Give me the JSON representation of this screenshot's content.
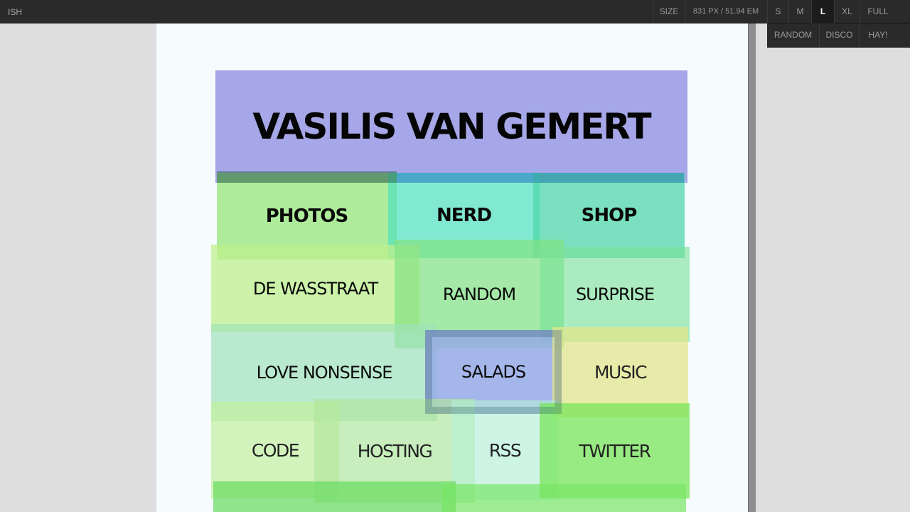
{
  "toolbar": {
    "logo": "ISH",
    "size_label": "SIZE",
    "size_value": "831 PX /  51.94 EM",
    "size_buttons": [
      {
        "label": "S"
      },
      {
        "label": "M"
      },
      {
        "label": "L",
        "active": true
      },
      {
        "label": "XL"
      },
      {
        "label": "FULL"
      }
    ],
    "mode_buttons": [
      {
        "label": "RANDOM"
      },
      {
        "label": "DISCO"
      },
      {
        "label": "HAY!"
      }
    ]
  },
  "page": {
    "title": "VASILIS VAN GEMERT",
    "tiles": [
      {
        "label": "PHOTOS"
      },
      {
        "label": "NERD"
      },
      {
        "label": "SHOP"
      },
      {
        "label": "DE WASSTRAAT"
      },
      {
        "label": "RANDOM"
      },
      {
        "label": "SURPRISE"
      },
      {
        "label": "LOVE NONSENSE"
      },
      {
        "label": "SALADS"
      },
      {
        "label": "MUSIC"
      },
      {
        "label": "CODE"
      },
      {
        "label": "HOSTING"
      },
      {
        "label": "RSS"
      },
      {
        "label": "TWITTER"
      }
    ]
  },
  "colors": {
    "toolbar_bg": "#2a2a2a",
    "header_bg": "#a5a7e8",
    "page_bg": "#f6fbfd"
  }
}
